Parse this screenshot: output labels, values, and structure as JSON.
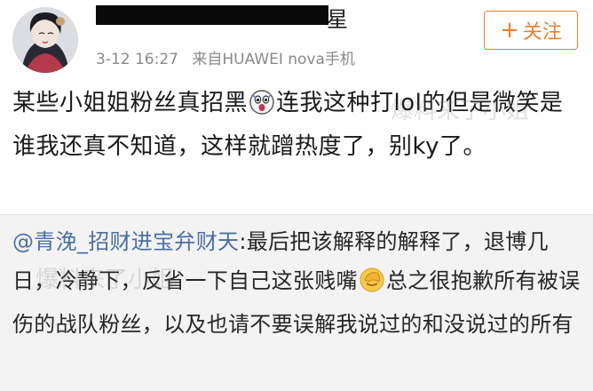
{
  "post": {
    "username_visible_suffix": "星",
    "time": "3-12 16:27",
    "source": "来自HUAWEI nova手机",
    "follow_label": "关注",
    "text_part1": "某些小姐姐粉丝真招黑",
    "text_part2": "连我这种打lol的但是微笑是谁我还真不知道，这样就蹭热度了，别ky了。"
  },
  "repost": {
    "mention": "@青浼_招财进宝弁财天",
    "text_part1": ":最后把该解释的解释了，退博几日，冷静下，反省一下自己这张贱嘴",
    "text_part2": "总之很抱歉所有被误伤的战队粉丝，以及也请不要误解我说过的和没说过的所有"
  },
  "watermark": {
    "line1": "爆料来了小姐",
    "line2": "爆料来了小姐"
  },
  "icons": {
    "avatar": "avatar-girl-illustration",
    "emoji1": "scared-face-emoji",
    "emoji2": "facepalm-emoji"
  }
}
